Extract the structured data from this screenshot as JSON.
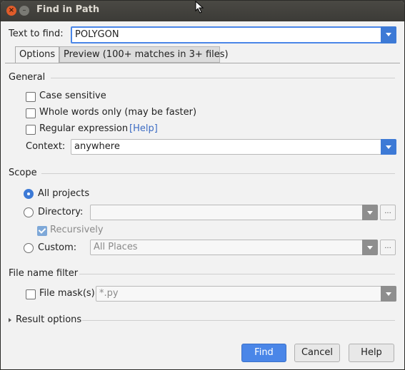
{
  "window": {
    "title": "Find in Path"
  },
  "find": {
    "label": "Text to find:",
    "value": "POLYGON"
  },
  "tabs": [
    {
      "label": "Options"
    },
    {
      "label": "Preview (100+ matches in 3+ files)"
    }
  ],
  "general": {
    "heading": "General",
    "case_sensitive": "Case sensitive",
    "whole_words": "Whole words only (may be faster)",
    "regex": "Regular expression",
    "help_link": "[Help]",
    "context_label": "Context:",
    "context_value": "anywhere"
  },
  "scope": {
    "heading": "Scope",
    "all_projects": "All projects",
    "directory_label": "Directory:",
    "directory_value": "",
    "recursively": "Recursively",
    "custom_label": "Custom:",
    "custom_value": "All Places",
    "ellipsis": "..."
  },
  "filter": {
    "heading": "File name filter",
    "file_mask_label": "File mask(s)",
    "file_mask_value": "*.py"
  },
  "result_options": {
    "label": "Result options"
  },
  "buttons": {
    "find": "Find",
    "cancel": "Cancel",
    "help": "Help"
  },
  "colors": {
    "accent": "#4a86e8",
    "titlebar": "#3c3b37",
    "close": "#e05c2a"
  }
}
